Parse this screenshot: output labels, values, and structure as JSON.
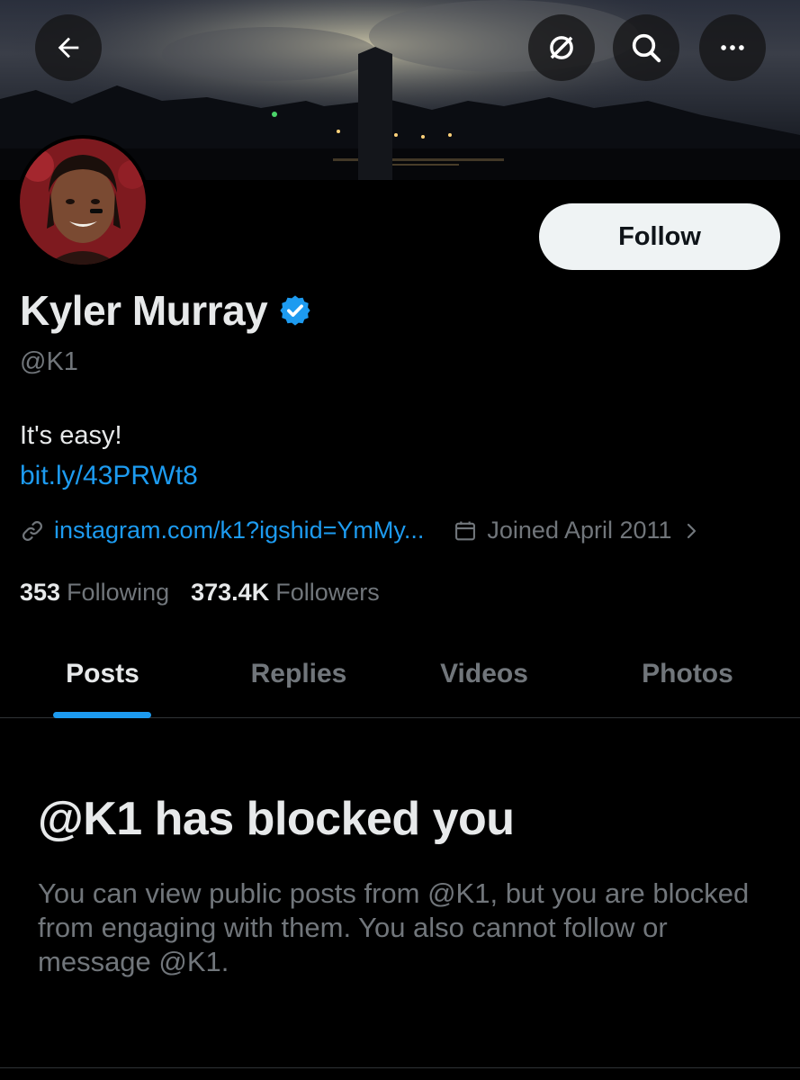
{
  "header": {
    "back_label": "Back",
    "icons": [
      "back-arrow-icon",
      "grok-icon",
      "search-icon",
      "more-icon"
    ]
  },
  "profile": {
    "display_name": "Kyler Murray",
    "verified": true,
    "handle": "@K1",
    "bio": "It's easy!",
    "bio_link": "bit.ly/43PRWt8",
    "website": "instagram.com/k1?igshid=YmMy...",
    "joined": "Joined April 2011"
  },
  "follow_button": {
    "label": "Follow"
  },
  "stats": {
    "following_count": "353",
    "following_label": "Following",
    "followers_count": "373.4K",
    "followers_label": "Followers"
  },
  "tabs": [
    {
      "label": "Posts",
      "active": true
    },
    {
      "label": "Replies",
      "active": false
    },
    {
      "label": "Videos",
      "active": false
    },
    {
      "label": "Photos",
      "active": false
    }
  ],
  "blocked": {
    "title": "@K1 has blocked you",
    "message": "You can view public posts from @K1, but you are blocked from engaging with them. You also cannot follow or message @K1."
  },
  "colors": {
    "accent": "#1d9bf0",
    "text_primary": "#e7e9ea",
    "text_secondary": "#71767b",
    "background": "#000000",
    "button_bg": "#eff3f4"
  }
}
